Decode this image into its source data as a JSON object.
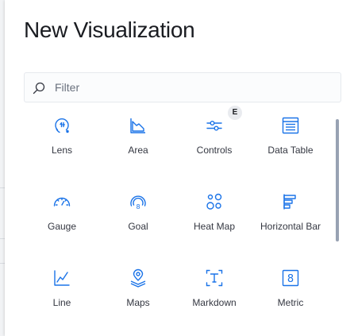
{
  "title": "New Visualization",
  "filter": {
    "placeholder": "Filter",
    "value": ""
  },
  "badge": "E",
  "colors": {
    "icon": "#1a73e8",
    "text": "#343741",
    "title": "#1a1c21"
  },
  "visualizations": [
    {
      "label": "Lens",
      "icon": "lens-icon"
    },
    {
      "label": "Area",
      "icon": "area-chart-icon"
    },
    {
      "label": "Controls",
      "icon": "controls-icon"
    },
    {
      "label": "Data Table",
      "icon": "data-table-icon"
    },
    {
      "label": "Gauge",
      "icon": "gauge-icon"
    },
    {
      "label": "Goal",
      "icon": "goal-icon"
    },
    {
      "label": "Heat Map",
      "icon": "heat-map-icon"
    },
    {
      "label": "Horizontal Bar",
      "icon": "horizontal-bar-icon"
    },
    {
      "label": "Line",
      "icon": "line-chart-icon"
    },
    {
      "label": "Maps",
      "icon": "maps-icon"
    },
    {
      "label": "Markdown",
      "icon": "markdown-icon"
    },
    {
      "label": "Metric",
      "icon": "metric-icon"
    }
  ]
}
